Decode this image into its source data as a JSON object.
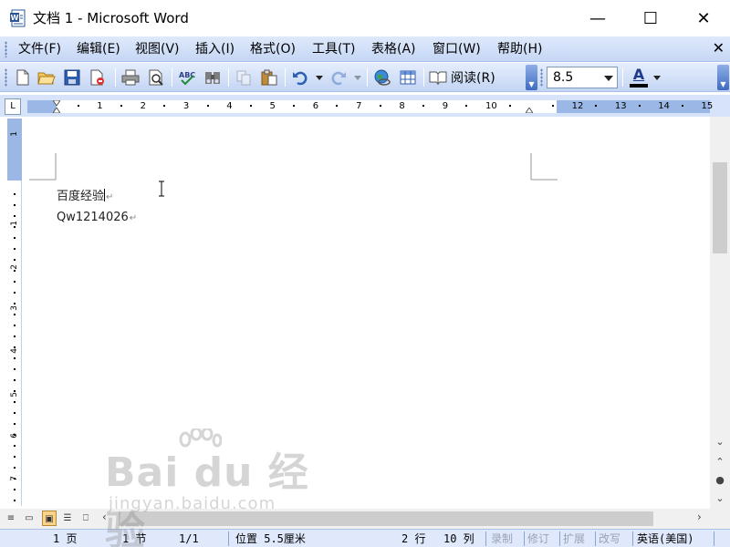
{
  "window": {
    "title": "文档 1 - Microsoft Word",
    "minimize": "—",
    "maximize": "☐",
    "close": "✕"
  },
  "menu": {
    "items": [
      {
        "label": "文件(F)"
      },
      {
        "label": "编辑(E)"
      },
      {
        "label": "视图(V)"
      },
      {
        "label": "插入(I)"
      },
      {
        "label": "格式(O)"
      },
      {
        "label": "工具(T)"
      },
      {
        "label": "表格(A)"
      },
      {
        "label": "窗口(W)"
      },
      {
        "label": "帮助(H)"
      }
    ],
    "close_doc": "✕"
  },
  "toolbar": {
    "reading_label": "阅读(R)",
    "font_size": "8.5",
    "font_color_glyph": "A"
  },
  "ruler": {
    "tab_selector": "L",
    "labels": [
      "1",
      "2",
      "3",
      "4",
      "5",
      "6",
      "7",
      "8",
      "9",
      "10",
      "12",
      "13",
      "14",
      "15"
    ]
  },
  "vruler": {
    "labels": [
      "1",
      "1",
      "2",
      "3",
      "4",
      "5",
      "6",
      "7"
    ]
  },
  "document": {
    "lines": [
      {
        "text": "百度经验"
      },
      {
        "text": "Qw1214026"
      }
    ],
    "paragraph_mark": "↵"
  },
  "status": {
    "page": "1 页",
    "section": "1 节",
    "page_of": "1/1",
    "position": "位置 5.5厘米",
    "line": "2 行",
    "column": "10 列",
    "rec": "录制",
    "trk": "修订",
    "ext": "扩展",
    "ovr": "改写",
    "language": "英语(美国)"
  },
  "watermark": {
    "big": "Bai du 经验",
    "small": "jingyan.baidu.com"
  }
}
